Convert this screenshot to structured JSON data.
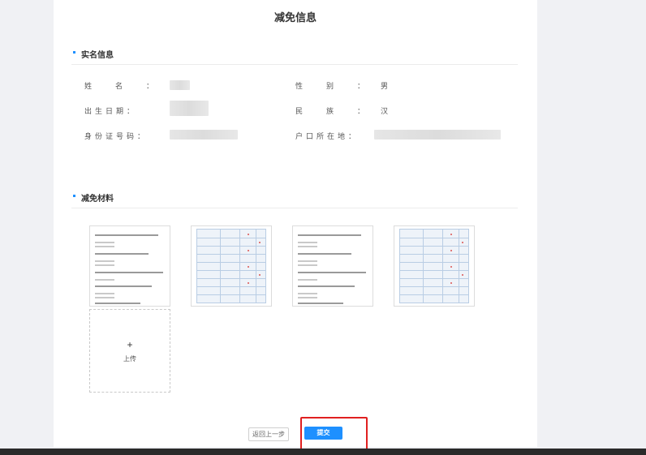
{
  "page": {
    "title": "减免信息"
  },
  "sections": {
    "identity": {
      "title": "实名信息",
      "fields": {
        "name": {
          "label": "姓名："
        },
        "gender": {
          "label": "性别：",
          "value": "男"
        },
        "birthdate": {
          "label": "出生日期："
        },
        "ethnicity": {
          "label": "民族：",
          "value": "汉"
        },
        "id_number": {
          "label": "身份证号码："
        },
        "household": {
          "label": "户口所在地："
        }
      }
    },
    "materials": {
      "title": "减免材料",
      "upload_plus": "+",
      "upload_label": "上传"
    }
  },
  "actions": {
    "back": "返回上一步",
    "submit": "提交"
  },
  "colors": {
    "accent": "#1e90ff",
    "highlight": "#e02020"
  }
}
